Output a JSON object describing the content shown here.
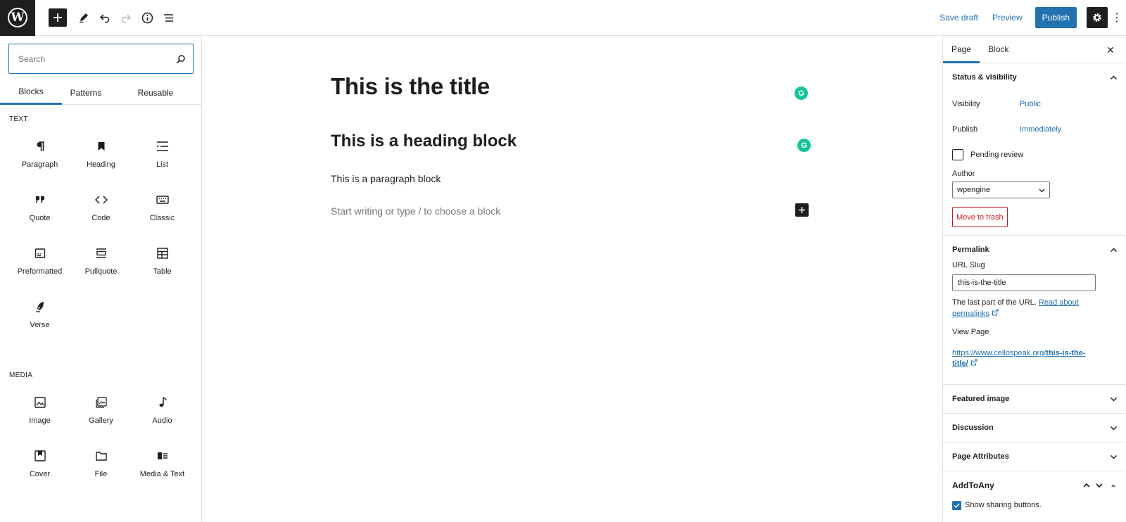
{
  "topbar": {
    "logo_letter": "W",
    "save_draft": "Save draft",
    "preview": "Preview",
    "publish": "Publish",
    "more": "⋮"
  },
  "left": {
    "search_placeholder": "Search",
    "tabs": [
      "Blocks",
      "Patterns",
      "Reusable"
    ],
    "active_tab": "Blocks",
    "categories": [
      {
        "label": "TEXT",
        "blocks": [
          {
            "label": "Paragraph",
            "icon": "paragraph-icon"
          },
          {
            "label": "Heading",
            "icon": "bookmark-icon"
          },
          {
            "label": "List",
            "icon": "list-icon"
          },
          {
            "label": "Quote",
            "icon": "quote-icon"
          },
          {
            "label": "Code",
            "icon": "code-icon"
          },
          {
            "label": "Classic",
            "icon": "keyboard-icon"
          },
          {
            "label": "Preformatted",
            "icon": "preformatted-icon"
          },
          {
            "label": "Pullquote",
            "icon": "pullquote-icon"
          },
          {
            "label": "Table",
            "icon": "table-icon"
          },
          {
            "label": "Verse",
            "icon": "feather-icon"
          }
        ]
      },
      {
        "label": "MEDIA",
        "blocks": [
          {
            "label": "Image",
            "icon": "image-icon"
          },
          {
            "label": "Gallery",
            "icon": "gallery-icon"
          },
          {
            "label": "Audio",
            "icon": "music-note-icon"
          },
          {
            "label": "Cover",
            "icon": "cover-icon"
          },
          {
            "label": "File",
            "icon": "folder-icon"
          },
          {
            "label": "Media & Text",
            "icon": "media-text-icon"
          }
        ]
      }
    ]
  },
  "canvas": {
    "title": "This is the title",
    "heading": "This is a heading block",
    "paragraph": "This is a paragraph block",
    "placeholder": "Start writing or type / to choose a block"
  },
  "sidebar": {
    "tabs": [
      "Page",
      "Block"
    ],
    "active_tab": "Page",
    "close": "✕",
    "status": {
      "title": "Status & visibility",
      "visibility_label": "Visibility",
      "visibility_value": "Public",
      "publish_label": "Publish",
      "publish_value": "Immediately",
      "pending_review": "Pending review",
      "author_label": "Author",
      "author_value": "wpengine",
      "trash": "Move to trash"
    },
    "permalink": {
      "title": "Permalink",
      "slug_label": "URL Slug",
      "slug_value": "this-is-the-title",
      "help_text": "The last part of the URL.",
      "help_link_1": "Read about",
      "help_link_2": "permalinks",
      "view_label": "View Page",
      "url_base": "https://www.cellospeak.org/",
      "url_slug_1": "this-is-the-",
      "url_slug_2": "title/"
    },
    "panels": [
      "Featured image",
      "Discussion",
      "Page Attributes"
    ],
    "addtoany": {
      "title": "AddToAny",
      "show_sharing": "Show sharing buttons."
    }
  },
  "colors": {
    "accent": "#2271b1",
    "dark": "#1e1e1e",
    "danger": "#cc1818",
    "grammarly": "#15c39a"
  }
}
